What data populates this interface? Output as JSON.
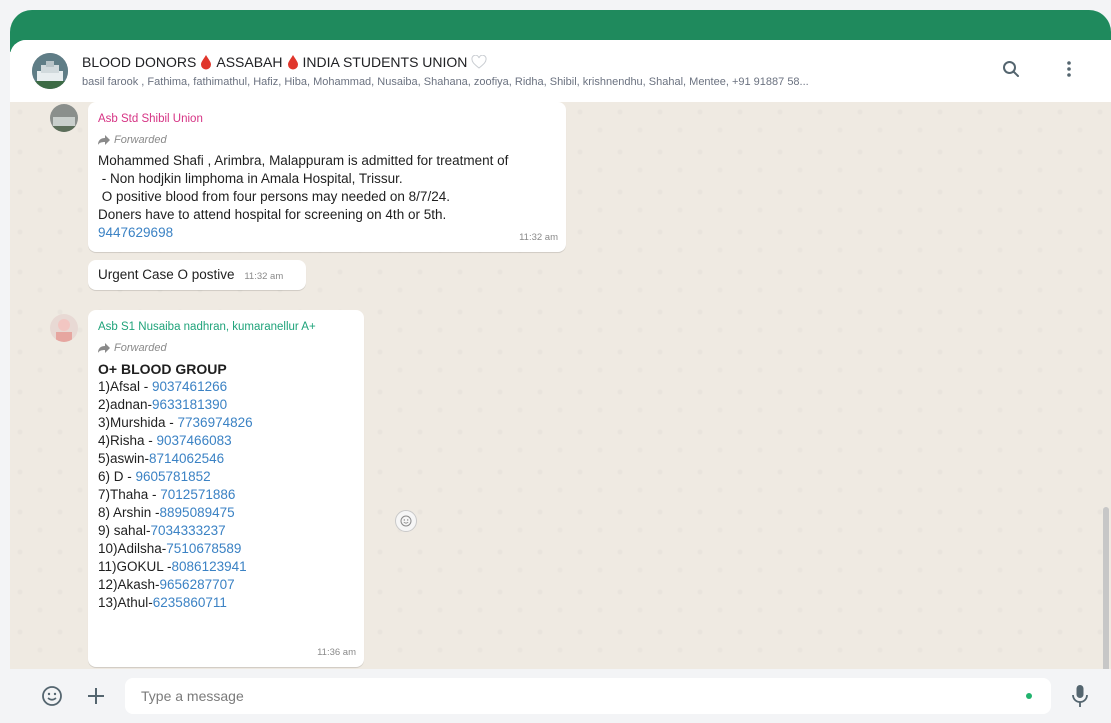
{
  "header": {
    "title_part1": "BLOOD DONORS",
    "title_part2": "ASSABAH",
    "title_part3": "INDIA STUDENTS UNION",
    "members": "basil farook , Fathima, fathimathul, Hafiz, Hiba, Mohammad, Nusaiba, Shahana, zoofiya, Ridha, Shibil, krishnendhu, Shahal, Mentee, +91 91887 58..."
  },
  "messages": {
    "m1": {
      "sender": "Asb Std Shibil Union",
      "sender_color": "#d63384",
      "forwarded": "Forwarded",
      "lines": [
        "Mohammed Shafi , Arimbra, Malappuram is admitted for treatment of",
        " - Non hodjkin limphoma in Amala Hospital, Trissur.",
        " O positive blood from four persons may needed on 8/7/24.",
        "Doners have to attend hospital for screening on 4th or 5th."
      ],
      "phone": "9447629698",
      "time": "11:32 am"
    },
    "m2": {
      "text": "Urgent Case O postive",
      "time": "11:32 am"
    },
    "m3": {
      "sender": "Asb S1 Nusaiba nadhran, kumaranellur A+",
      "sender_color": "#1fa37a",
      "forwarded": "Forwarded",
      "heading": "O+ BLOOD GROUP",
      "donors": [
        {
          "name": "1)Afsal - ",
          "phone": "9037461266"
        },
        {
          "name": "2)adnan-",
          "phone": "9633181390"
        },
        {
          "name": "3)Murshida - ",
          "phone": "7736974826"
        },
        {
          "name": "4)Risha - ",
          "phone": "9037466083"
        },
        {
          "name": "5)aswin-",
          "phone": "8714062546"
        },
        {
          "name": "6) D - ",
          "phone": "9605781852"
        },
        {
          "name": "7)Thaha - ",
          "phone": "7012571886"
        },
        {
          "name": "8) Arshin -",
          "phone": "8895089475"
        },
        {
          "name": "9) sahal-",
          "phone": "7034333237"
        },
        {
          "name": "10)Adilsha-",
          "phone": "7510678589"
        },
        {
          "name": "11)GOKUL -",
          "phone": "8086123941"
        },
        {
          "name": "12)Akash-",
          "phone": "9656287707"
        },
        {
          "name": "13)Athul-",
          "phone": "6235860711"
        }
      ],
      "time": "11:36 am"
    }
  },
  "composer": {
    "placeholder": "Type a message"
  },
  "colors": {
    "accent_green": "#1f8a5d",
    "link_blue": "#3b82c4",
    "blood_red": "#e0362c"
  }
}
